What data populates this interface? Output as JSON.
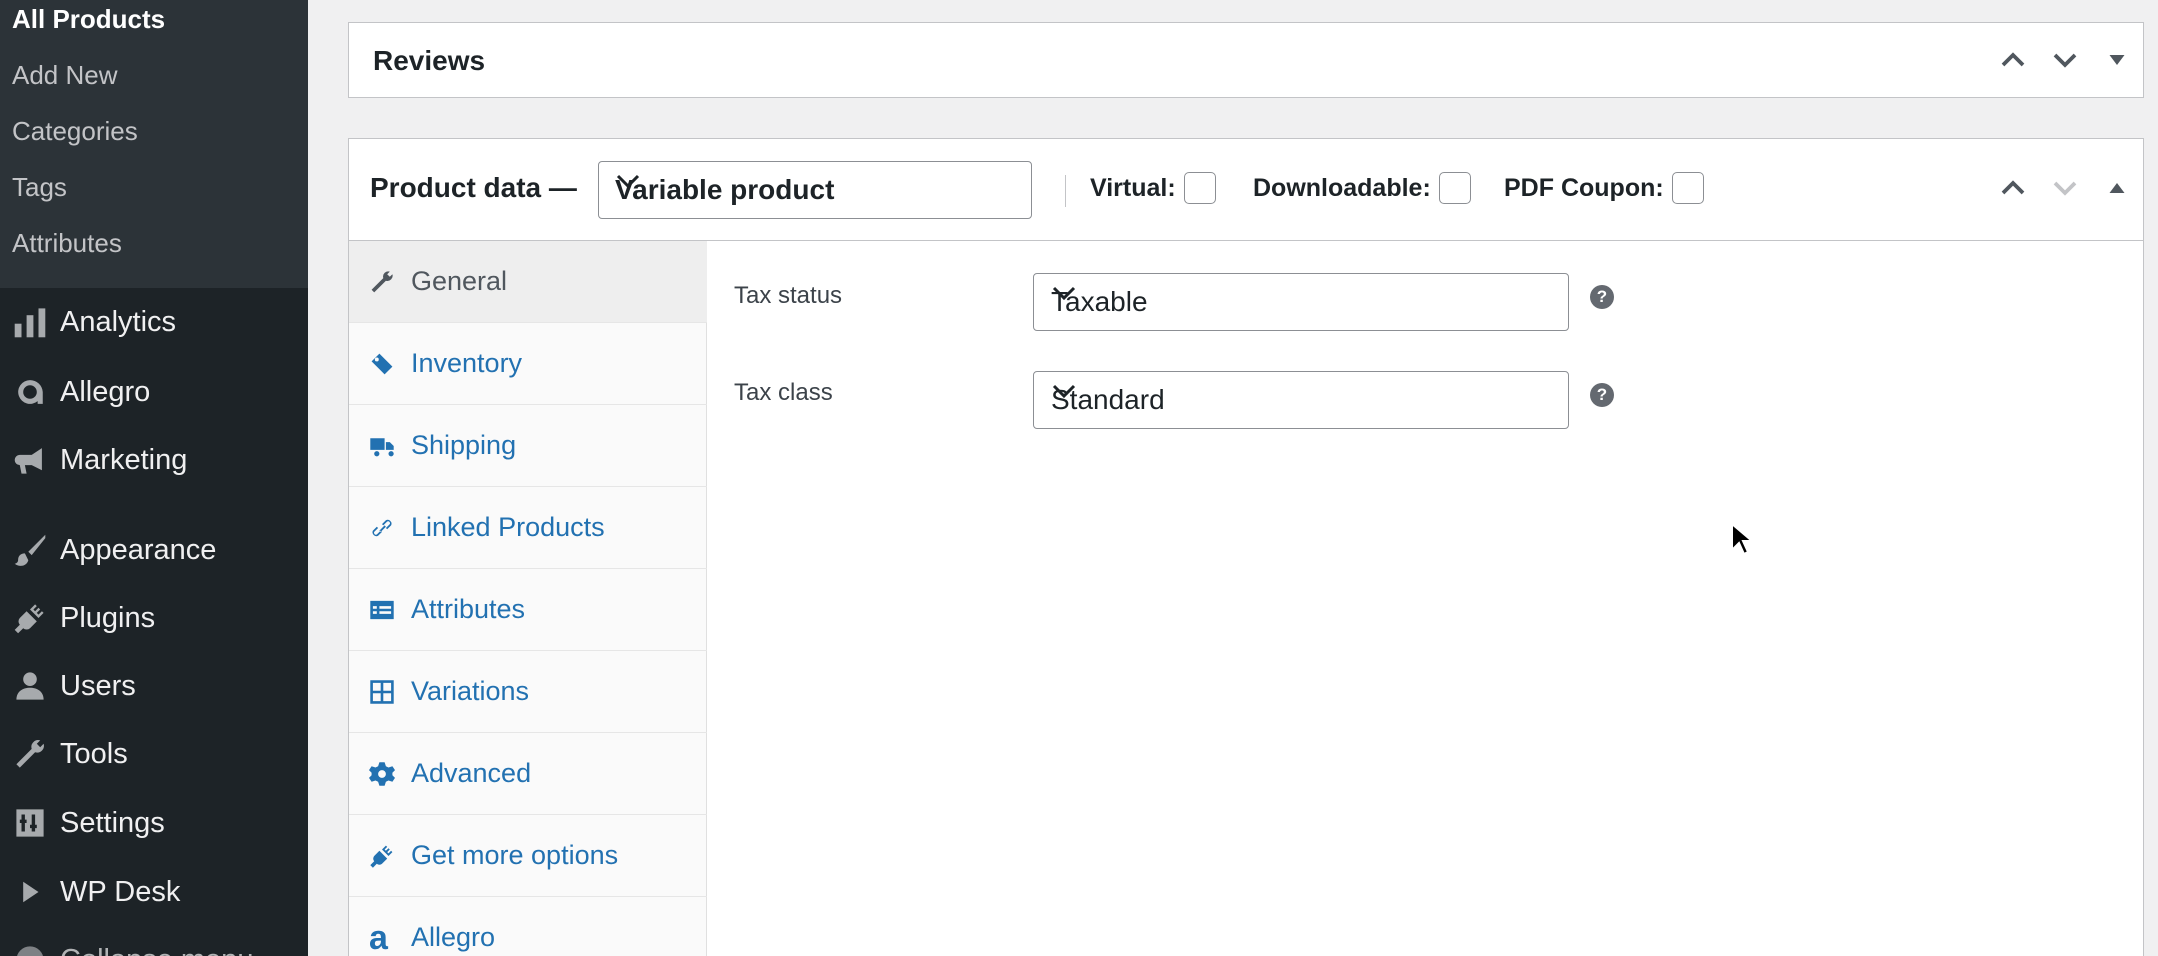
{
  "sidebar": {
    "submenu": [
      {
        "label": "All Products",
        "current": true
      },
      {
        "label": "Add New",
        "current": false
      },
      {
        "label": "Categories",
        "current": false
      },
      {
        "label": "Tags",
        "current": false
      },
      {
        "label": "Attributes",
        "current": false
      }
    ],
    "menu": [
      {
        "label": "Analytics",
        "icon": "bar-chart-icon"
      },
      {
        "label": "Allegro",
        "icon": "allegro-icon"
      },
      {
        "label": "Marketing",
        "icon": "megaphone-icon"
      },
      {
        "label": "Appearance",
        "icon": "paintbrush-icon"
      },
      {
        "label": "Plugins",
        "icon": "plug-icon"
      },
      {
        "label": "Users",
        "icon": "user-icon"
      },
      {
        "label": "Tools",
        "icon": "wrench-icon"
      },
      {
        "label": "Settings",
        "icon": "settings-sliders-icon"
      },
      {
        "label": "WP Desk",
        "icon": "play-triangle-icon"
      },
      {
        "label": "Collapse menu",
        "icon": "collapse-icon"
      }
    ]
  },
  "reviews_box": {
    "title": "Reviews"
  },
  "product_data": {
    "title": "Product data —",
    "product_type": "Variable product",
    "options": [
      {
        "label": "Virtual:",
        "checked": false
      },
      {
        "label": "Downloadable:",
        "checked": false
      },
      {
        "label": "PDF Coupon:",
        "checked": false
      }
    ],
    "tabs": [
      {
        "label": "General",
        "icon": "wrench-icon",
        "active": true
      },
      {
        "label": "Inventory",
        "icon": "tag-icon",
        "active": false
      },
      {
        "label": "Shipping",
        "icon": "truck-icon",
        "active": false
      },
      {
        "label": "Linked Products",
        "icon": "link-icon",
        "active": false
      },
      {
        "label": "Attributes",
        "icon": "list-icon",
        "active": false
      },
      {
        "label": "Variations",
        "icon": "grid-icon",
        "active": false
      },
      {
        "label": "Advanced",
        "icon": "gear-icon",
        "active": false
      },
      {
        "label": "Get more options",
        "icon": "plugin-icon",
        "active": false
      },
      {
        "label": "Allegro",
        "icon": "allegro-icon",
        "active": false
      }
    ],
    "general": {
      "tax_status": {
        "label": "Tax status",
        "value": "Taxable"
      },
      "tax_class": {
        "label": "Tax class",
        "value": "Standard"
      }
    }
  },
  "colors": {
    "sidebar_bg": "#1d2327",
    "submenu_bg": "#2c3338",
    "link_blue": "#2271b1",
    "page_bg": "#f0f0f1"
  }
}
